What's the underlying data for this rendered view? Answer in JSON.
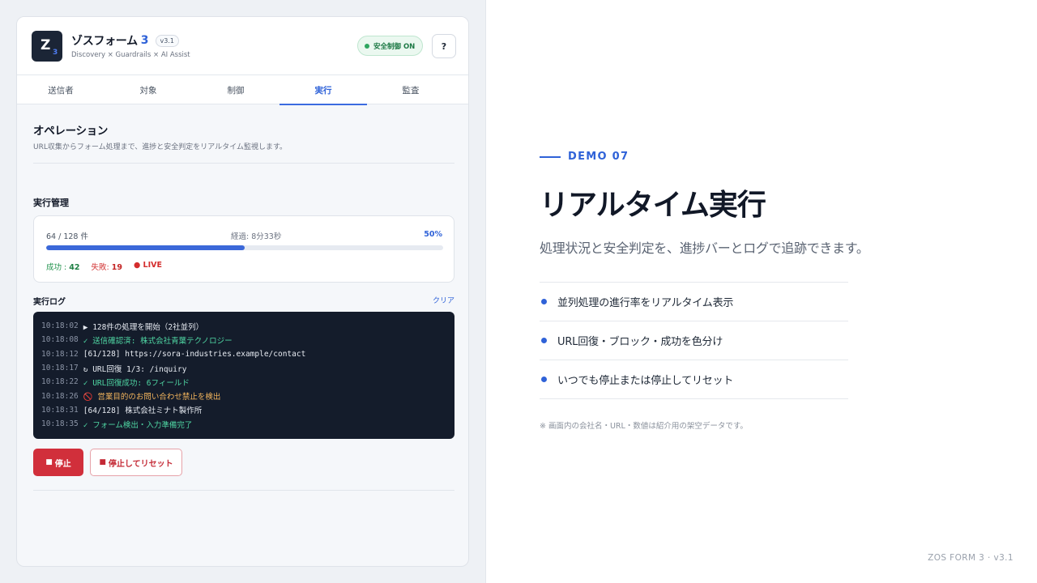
{
  "app": {
    "logo_letter": "Z",
    "logo_sub": "3",
    "title": "ゾスフォーム",
    "title_num": "3",
    "version": "v3.1",
    "subtitle": "Discovery × Guardrails × AI Assist",
    "safety_badge": "安全制御 ON",
    "help_label": "?"
  },
  "tabs": [
    {
      "label": "送信者",
      "active": false
    },
    {
      "label": "対象",
      "active": false
    },
    {
      "label": "制御",
      "active": false
    },
    {
      "label": "実行",
      "active": true
    },
    {
      "label": "監査",
      "active": false
    }
  ],
  "operation": {
    "title": "オペレーション",
    "description": "URL収集からフォーム処理まで、進捗と安全判定をリアルタイム監視します。"
  },
  "management": {
    "title": "実行管理",
    "count_text": "64 / 128 件",
    "elapsed_text": "経過: 8分33秒",
    "percent_text": "50%",
    "progress_fraction": 0.5,
    "success_label": "成功 : ",
    "success_value": "42",
    "fail_label": "失敗: ",
    "fail_value": "19",
    "live_label": "● LIVE"
  },
  "log": {
    "title": "実行ログ",
    "clear_label": "クリア",
    "lines": [
      {
        "time": "10:18:02",
        "msg": "▶ 128件の処理を開始（2社並列）",
        "kind": "plain"
      },
      {
        "time": "10:18:08",
        "msg": "✓ 送信確認済: 株式会社青葉テクノロジー",
        "kind": "ok"
      },
      {
        "time": "10:18:12",
        "msg": "[61/128] https://sora-industries.example/contact",
        "kind": "plain"
      },
      {
        "time": "10:18:17",
        "msg": "↻ URL回復 1/3: /inquiry",
        "kind": "plain"
      },
      {
        "time": "10:18:22",
        "msg": "✓ URL回復成功: 6フィールド",
        "kind": "ok"
      },
      {
        "time": "10:18:26",
        "msg": "🚫 営業目的のお問い合わせ禁止を検出",
        "kind": "warn"
      },
      {
        "time": "10:18:31",
        "msg": "[64/128] 株式会社ミナト製作所",
        "kind": "plain"
      },
      {
        "time": "10:18:35",
        "msg": "✓ フォーム検出・入力準備完了",
        "kind": "ok"
      }
    ]
  },
  "buttons": {
    "stop_icon": "■",
    "stop_label": "停止",
    "reset_icon": "■",
    "reset_label": "停止してリセット"
  },
  "promo": {
    "demo_label": "DEMO 07",
    "title": "リアルタイム実行",
    "subtitle": "処理状況と安全判定を、進捗バーとログで追跡できます。",
    "features": [
      "並列処理の進行率をリアルタイム表示",
      "URL回復・ブロック・成功を色分け",
      "いつでも停止または停止してリセット"
    ],
    "disclaimer": "※ 画面内の会社名・URL・数値は紹介用の架空データです。",
    "footer": "ZOS FORM 3 · v3.1"
  },
  "colors": {
    "accent": "#2f62d8",
    "danger": "#d12f3b",
    "success": "#24944f",
    "terminal_bg": "#141c2b"
  }
}
